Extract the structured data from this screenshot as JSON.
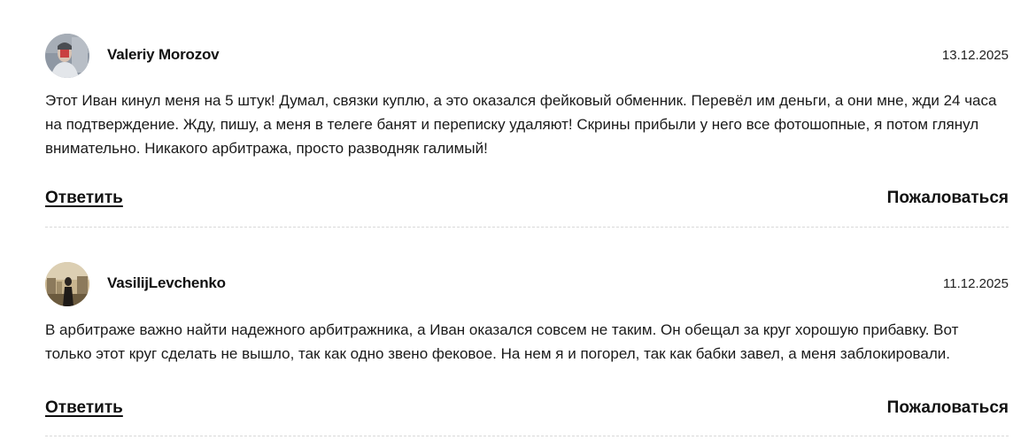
{
  "comments": [
    {
      "author": "Valeriy Morozov",
      "date": "13.12.2025",
      "text": "Этот Иван кинул меня на 5 штук! Думал, связки куплю, а это оказался фейковый обменник. Перевёл им деньги, а они мне, жди 24 часа на подтверждение. Жду, пишу, а меня в телеге банят и переписку удаляют! Скрины прибыли у него все фотошопные, я потом глянул внимательно. Никакого арбитража, просто разводняк галимый!",
      "reply_label": "Ответить",
      "report_label": "Пожаловаться"
    },
    {
      "author": "VasilijLevchenko",
      "date": "11.12.2025",
      "text": "В арбитраже важно найти надежного арбитражника, а Иван оказался совсем не таким. Он обещал за круг хорошую прибавку. Вот только этот круг сделать не вышло, так как одно звено фековое. На нем я и погорел, так как бабки завел, а меня заблокировали.",
      "reply_label": "Ответить",
      "report_label": "Пожаловаться"
    }
  ]
}
